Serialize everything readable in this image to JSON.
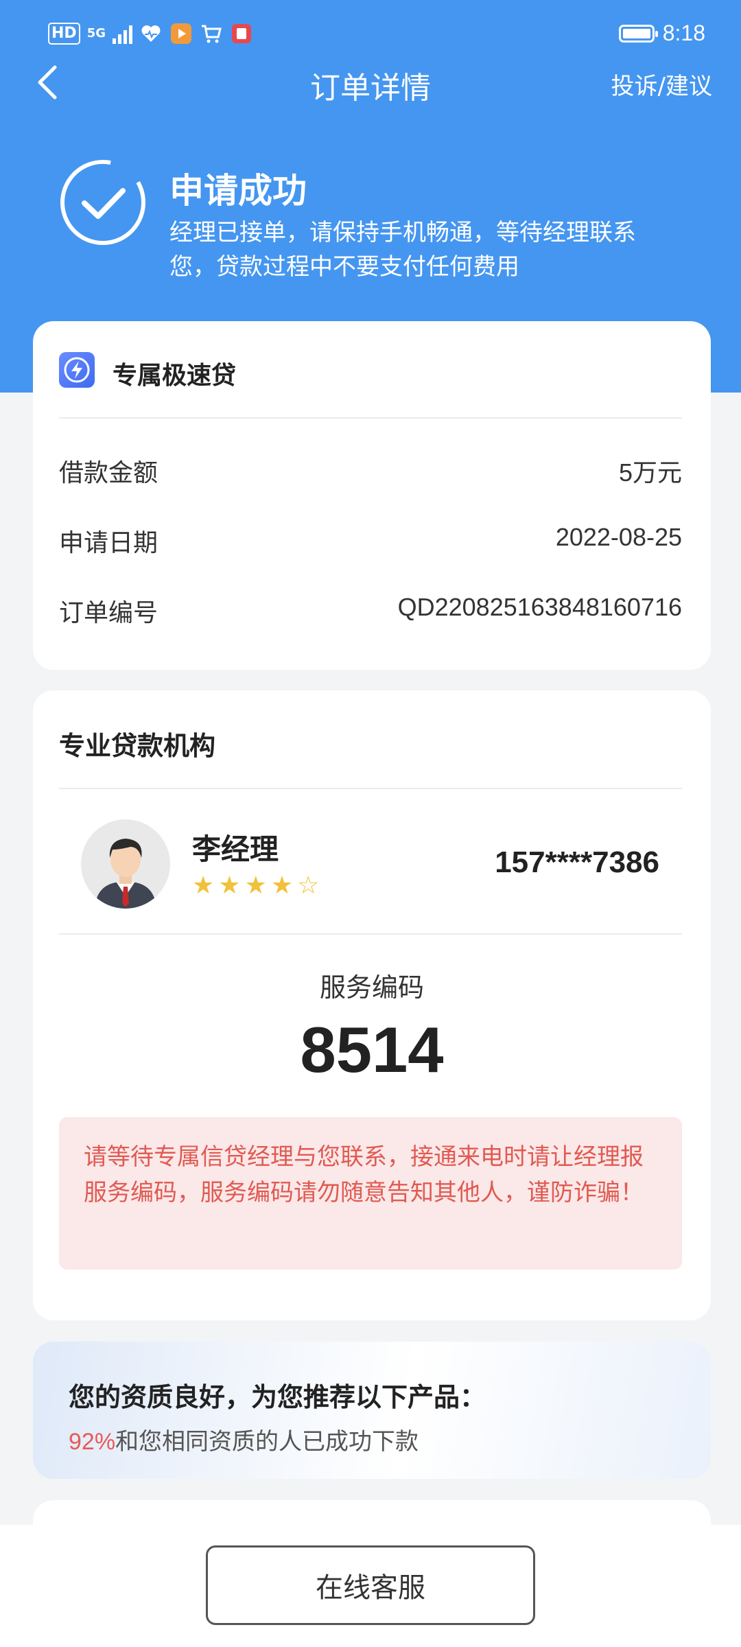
{
  "status_bar": {
    "network_badge": "HD",
    "network_type": "5G",
    "time": "8:18"
  },
  "header": {
    "back_icon": "chevron-left-icon",
    "title": "订单详情",
    "action": "投诉/建议"
  },
  "success": {
    "icon": "check-circle-icon",
    "title": "申请成功",
    "description": "经理已接单，请保持手机畅通，等待经理联系您，贷款过程中不要支付任何费用"
  },
  "product_card": {
    "icon": "lightning-icon",
    "name": "专属极速贷",
    "rows": [
      {
        "label": "借款金额",
        "value": "5万元"
      },
      {
        "label": "申请日期",
        "value": "2022-08-25"
      },
      {
        "label": "订单编号",
        "value": "QD220825163848160716"
      }
    ]
  },
  "org_card": {
    "title": "专业贷款机构",
    "manager": {
      "name": "李经理",
      "rating": 4,
      "rating_max": 5,
      "phone": "157****7386"
    },
    "service_code_label": "服务编码",
    "service_code": "8514",
    "warning": "请等待专属信贷经理与您联系，接通来电时请让经理报服务编码，服务编码请勿随意告知其他人，谨防诈骗！"
  },
  "recommend": {
    "title": "您的资质良好，为您推荐以下产品：",
    "percent": "92%",
    "subtitle": "和您相同资质的人已成功下款"
  },
  "bottom": {
    "service_button": "在线客服"
  },
  "colors": {
    "primary": "#4596f0",
    "warning_text": "#e05a52",
    "warning_bg": "#fbe8e8",
    "star": "#f0c23b"
  }
}
